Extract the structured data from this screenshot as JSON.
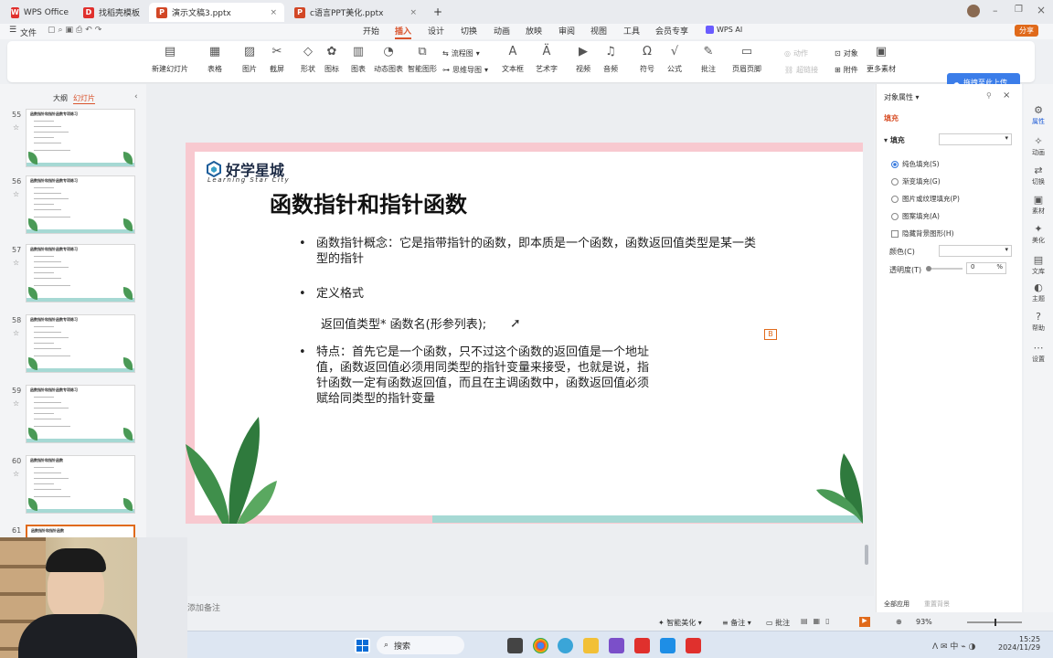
{
  "titlebar": {
    "tabs": [
      {
        "label": "WPS Office",
        "icon": "wps-logo-icon"
      },
      {
        "label": "找稻壳模板",
        "icon": "docer-icon"
      },
      {
        "label": "演示文稿3.pptx",
        "icon": "ppt-icon"
      },
      {
        "label": "c语言PPT美化.pptx",
        "icon": "ppt-icon"
      }
    ],
    "new_tab": "+"
  },
  "menubar": {
    "file": "文件",
    "items": [
      "开始",
      "插入",
      "设计",
      "切换",
      "动画",
      "放映",
      "审阅",
      "视图",
      "工具",
      "会员专享"
    ],
    "active": "插入",
    "wps_ai": "WPS AI",
    "share": "分享"
  },
  "ribbon": {
    "buttons": [
      "新建幻灯片",
      "表格",
      "图片",
      "截屏",
      "形状",
      "图标",
      "图表",
      "动态图表",
      "智能图形",
      "文本框",
      "艺术字",
      "视频",
      "音频",
      "符号",
      "公式",
      "批注",
      "页眉页脚",
      "附件",
      "更多素材"
    ],
    "small": {
      "flowchart": "流程图",
      "mindmap": "思维导图",
      "action": "动作",
      "hyperlink": "超链接",
      "object": "对象"
    },
    "upload_button": "拖拽至此上传"
  },
  "leftpanel": {
    "tabs": [
      "大纲",
      "幻灯片"
    ],
    "active_tab": "幻灯片",
    "slides": [
      {
        "num": "55",
        "title": "函数指针和指针函数专项练习"
      },
      {
        "num": "56",
        "title": "函数指针和指针函数专项练习"
      },
      {
        "num": "57",
        "title": "函数指针和指针函数专项练习"
      },
      {
        "num": "58",
        "title": "函数指针和指针函数专项练习"
      },
      {
        "num": "59",
        "title": "函数指针和指针函数专项练习"
      },
      {
        "num": "60",
        "title": "函数指针和指针函数"
      },
      {
        "num": "61",
        "title": "函数指针和指针函数"
      }
    ]
  },
  "slide": {
    "logo_name": "好学星城",
    "logo_sub": "Learning Star City",
    "title": "函数指针和指针函数",
    "bullets": [
      "函数指针概念：它是指带指针的函数，即本质是一个函数，函数返回值类型是某一类型的指针",
      "定义格式",
      "特点：首先它是一个函数，只不过这个函数的返回值是一个地址值，函数返回值必须用同类型的指针变量来接受，也就是说，指针函数一定有函数返回值，而且在主调函数中，函数返回值必须赋给同类型的指针变量"
    ],
    "bullet1_line1": "函数指针概念：它是指带指针的函数，即本质是一个函数，函数返回值类型是某一类",
    "bullet1_line2": "型的指针",
    "bullet3_lines": [
      "特点：首先它是一个函数，只不过这个函数的返回值是一个地址",
      "值，函数返回值必须用同类型的指针变量来接受，也就是说，指",
      "针函数一定有函数返回值，而且在主调函数中，函数返回值必须",
      "赋给同类型的指针变量"
    ],
    "syntax": "返回值类型* 函数名(形参列表);"
  },
  "notes_placeholder": "添加备注",
  "rightpanel": {
    "title": "对象属性",
    "tab_fill": "填充",
    "section_fill": "填充",
    "options": [
      "纯色填充(S)",
      "渐变填充(G)",
      "图片或纹理填充(P)",
      "图案填充(A)"
    ],
    "selected_option": "纯色填充(S)",
    "hide_bg": "隐藏背景图形(H)",
    "color_label": "颜色(C)",
    "transparency_label": "透明度(T)",
    "transparency_value": "0",
    "percent": "%",
    "apply_all": "全部应用",
    "reset_bg": "重置背景"
  },
  "sidebar": {
    "items": [
      {
        "label": "属性",
        "icon": "properties-icon"
      },
      {
        "label": "动画",
        "icon": "animation-icon"
      },
      {
        "label": "切换",
        "icon": "transition-icon"
      },
      {
        "label": "素材",
        "icon": "assets-icon"
      },
      {
        "label": "美化",
        "icon": "beautify-icon"
      },
      {
        "label": "文库",
        "icon": "library-icon"
      },
      {
        "label": "主题",
        "icon": "theme-icon"
      },
      {
        "label": "帮助",
        "icon": "help-icon"
      },
      {
        "label": "设置",
        "icon": "settings-icon"
      }
    ]
  },
  "statusbar": {
    "smart_beautify": "智能美化",
    "notes": "备注",
    "comments": "批注",
    "zoom": "93%"
  },
  "taskbar": {
    "search": "搜索",
    "time": "15:25",
    "date": "2024/11/29",
    "lang": "中"
  },
  "colors": {
    "accent": "#d9532c",
    "slide_border": "#f8c9d0",
    "teal": "#a6d9d4",
    "wps_red": "#e0302d"
  }
}
